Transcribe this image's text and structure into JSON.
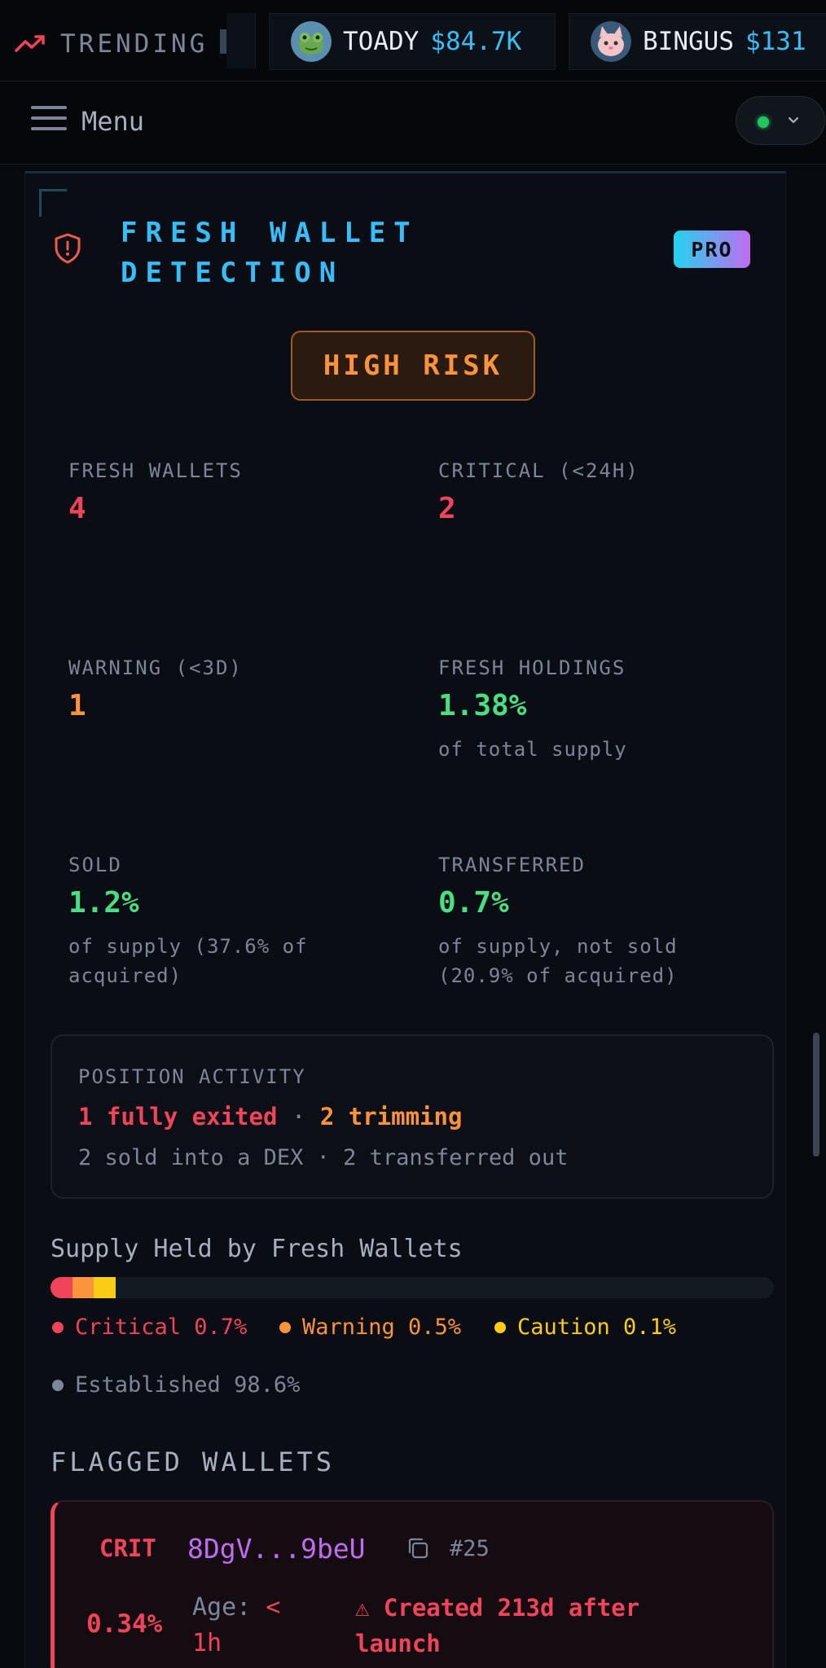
{
  "ticker": {
    "label": "TRENDING",
    "coins": [
      {
        "symbol": "TOADY",
        "price": "$84.7K",
        "avatar_icon": "frog-avatar-icon"
      },
      {
        "symbol": "BINGUS",
        "price": "$131",
        "avatar_icon": "cat-avatar-icon"
      }
    ]
  },
  "menubar": {
    "label": "Menu",
    "status_color": "#22c55e"
  },
  "panel": {
    "title": "FRESH WALLET DETECTION",
    "badge": "PRO",
    "risk": "HIGH RISK",
    "stats": [
      {
        "label": "FRESH WALLETS",
        "value": "4",
        "sub": ""
      },
      {
        "label": "CRITICAL (<24H)",
        "value": "2",
        "sub": ""
      },
      {
        "label": "WARNING (<3D)",
        "value": "1",
        "sub": ""
      },
      {
        "label": "FRESH HOLDINGS",
        "value": "1.38%",
        "sub": "of total supply"
      },
      {
        "label": "SOLD",
        "value": "1.2%",
        "sub": "of supply (37.6% of acquired)"
      },
      {
        "label": "TRANSFERRED",
        "value": "0.7%",
        "sub": "of supply, not sold (20.9% of acquired)"
      }
    ],
    "position_activity": {
      "label": "POSITION ACTIVITY",
      "exited": "1 fully exited",
      "separator": "·",
      "trimming": "2 trimming",
      "detail": "2 sold into a DEX · 2 transferred out"
    },
    "supply": {
      "title": "Supply Held by Fresh Wallets",
      "segments": [
        {
          "name": "Critical",
          "label": "Critical 0.7%",
          "value": 0.7,
          "color": "#ef4459"
        },
        {
          "name": "Warning",
          "label": "Warning 0.5%",
          "value": 0.5,
          "color": "#fb923c"
        },
        {
          "name": "Caution",
          "label": "Caution 0.1%",
          "value": 0.1,
          "color": "#facc15"
        },
        {
          "name": "Established",
          "label": "Established 98.6%",
          "value": 98.6,
          "color": "#7d8699"
        }
      ]
    },
    "flagged": {
      "title": "FLAGGED WALLETS",
      "wallets": [
        {
          "tag": "CRIT",
          "address": "8DgV...9beU",
          "rank": "#25",
          "percent": "0.34%",
          "age_label": "Age:",
          "age_value": "< 1h",
          "note": "⚠ Created 213d after launch"
        }
      ]
    }
  }
}
